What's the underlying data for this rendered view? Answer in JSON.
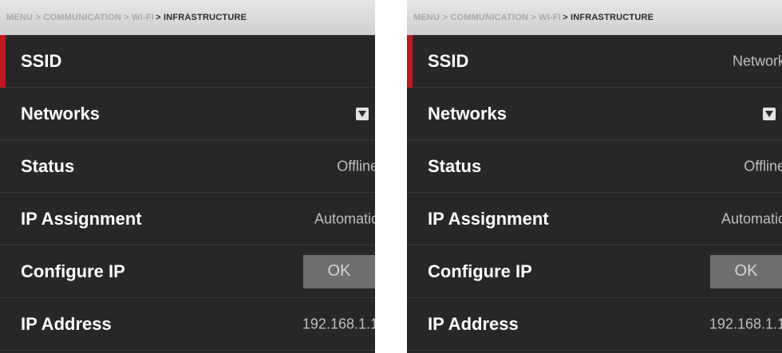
{
  "breadcrumb": {
    "path": "MENU > COMMUNICATION > WI-FI",
    "current": "> INFRASTRUCTURE"
  },
  "left": {
    "rows": [
      {
        "label": "SSID",
        "value": ""
      },
      {
        "label": "Networks",
        "icon": "chevron-down-icon"
      },
      {
        "label": "Status",
        "value": "Offline"
      },
      {
        "label": "IP Assignment",
        "value": "Automatic"
      },
      {
        "label": "Configure IP",
        "button": "OK"
      },
      {
        "label": "IP Address",
        "value": "192.168.1.1"
      }
    ]
  },
  "right": {
    "rows": [
      {
        "label": "SSID",
        "value": "Network"
      },
      {
        "label": "Networks",
        "icon": "chevron-down-icon"
      },
      {
        "label": "Status",
        "value": "Offline"
      },
      {
        "label": "IP Assignment",
        "value": "Automatic"
      },
      {
        "label": "Configure IP",
        "button": "OK"
      },
      {
        "label": "IP Address",
        "value": "192.168.1.1"
      }
    ]
  },
  "colors": {
    "accent": "#c4161c",
    "panel_bg": "#272727",
    "header_bg": "#d9d9d9",
    "label_text": "#ffffff",
    "value_text": "#bfbfbf",
    "button_bg": "#6e6e6e"
  }
}
